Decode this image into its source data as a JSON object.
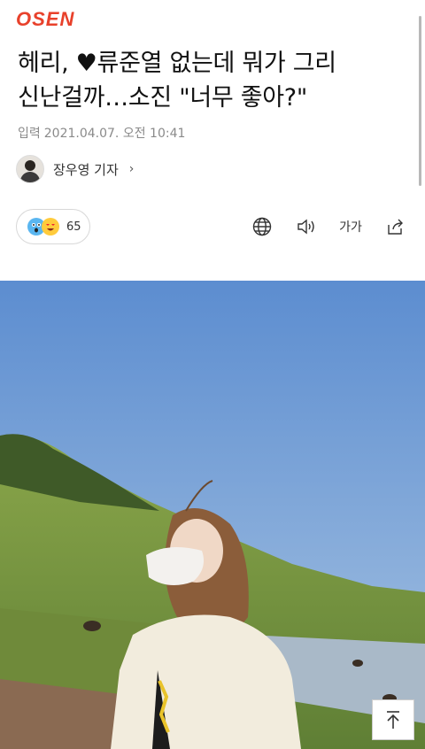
{
  "header": {
    "logo": "OSEN"
  },
  "article": {
    "headline_line1": "헤리, ♥류준열 없는데 뭐가 그리",
    "headline_line2": "신난걸까…소진 \"너무 좋아?\"",
    "date_prefix": "입력",
    "date": "2021.04.07. 오전 10:41",
    "reporter": "장우영 기자",
    "reaction_count": "65"
  },
  "toolbar": {
    "font_label": "가가"
  },
  "icons": [
    "globe-icon",
    "speaker-icon",
    "font-size-icon",
    "share-icon",
    "arrow-up-icon"
  ],
  "colors": {
    "brand": "#e8412b",
    "sky": "#6a9ad6",
    "grass": "#7a9a4a"
  }
}
